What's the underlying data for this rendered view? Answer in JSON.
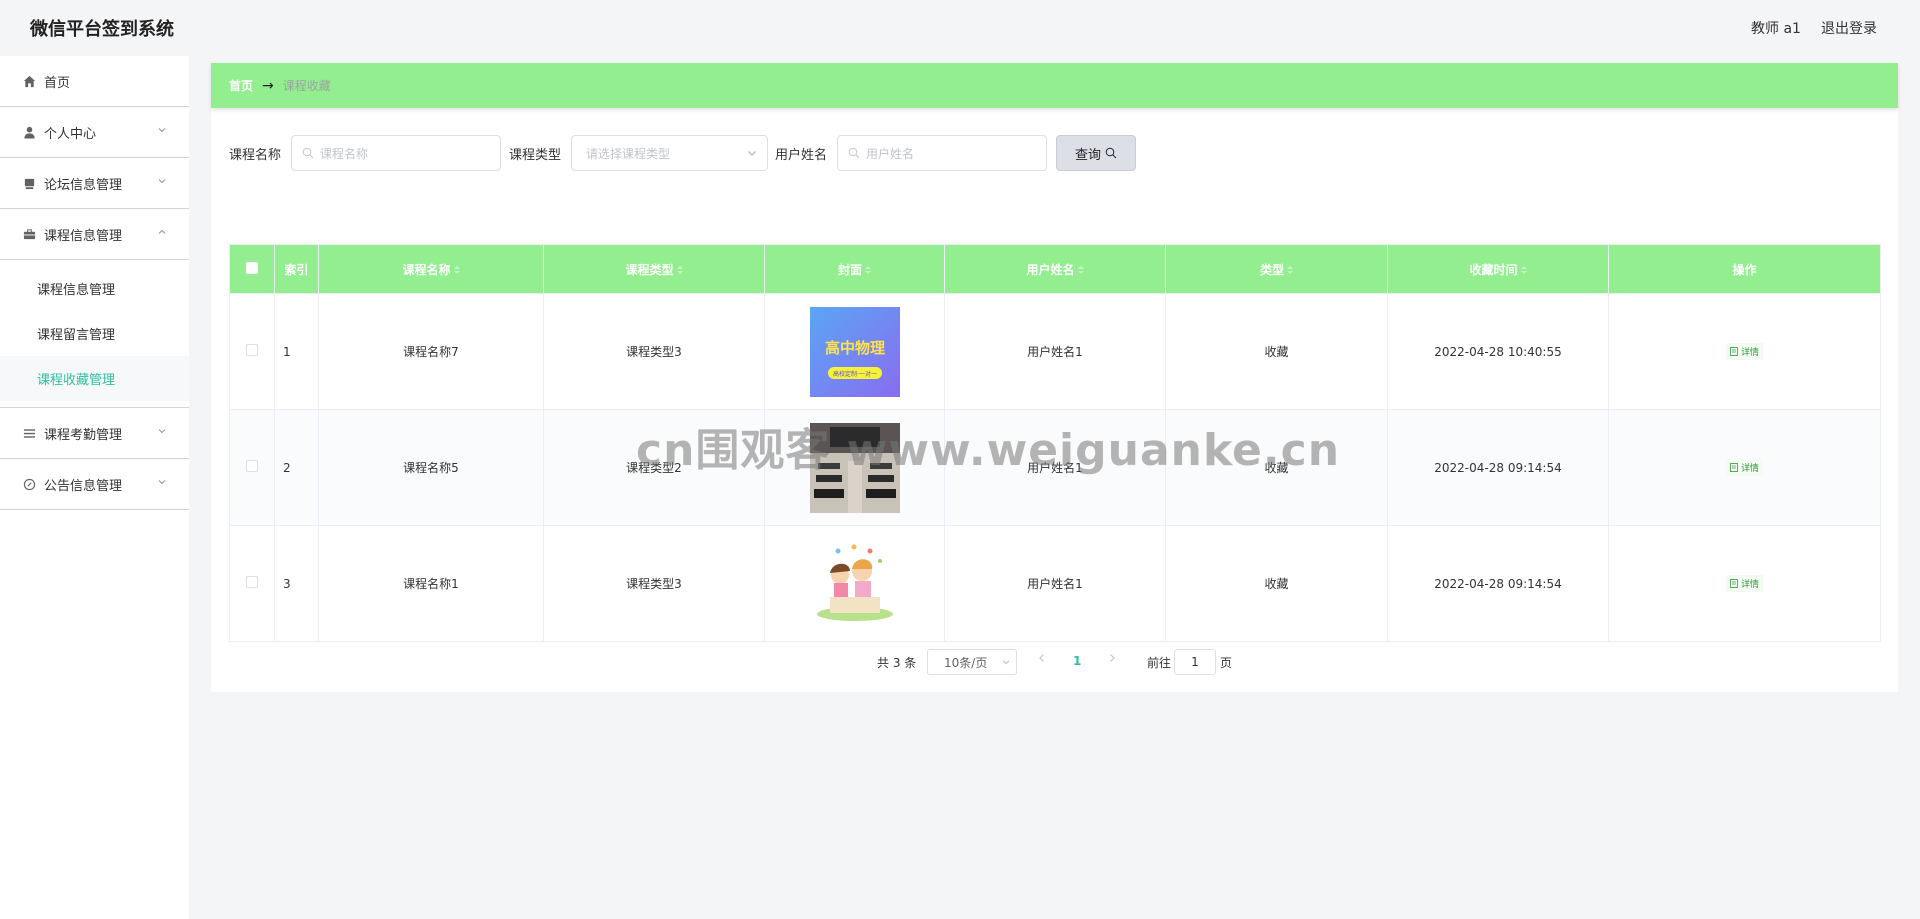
{
  "header": {
    "app_title": "微信平台签到系统",
    "user": "教师 a1",
    "logout": "退出登录"
  },
  "sidebar": {
    "items": [
      {
        "label": "首页",
        "icon": "home-icon"
      },
      {
        "label": "个人中心",
        "icon": "user-icon"
      },
      {
        "label": "论坛信息管理",
        "icon": "forum-icon"
      },
      {
        "label": "课程信息管理",
        "icon": "briefcase-icon"
      },
      {
        "label": "课程考勤管理",
        "icon": "list-icon"
      },
      {
        "label": "公告信息管理",
        "icon": "compass-icon"
      }
    ],
    "submenu": [
      {
        "label": "课程信息管理",
        "active": false
      },
      {
        "label": "课程留言管理",
        "active": false
      },
      {
        "label": "课程收藏管理",
        "active": true
      }
    ]
  },
  "breadcrumb": {
    "home": "首页",
    "separator": "→",
    "current": "课程收藏"
  },
  "search": {
    "course_name_label": "课程名称",
    "course_name_placeholder": "课程名称",
    "course_type_label": "课程类型",
    "course_type_placeholder": "请选择课程类型",
    "user_name_label": "用户姓名",
    "user_name_placeholder": "用户姓名",
    "query_button": "查询"
  },
  "table": {
    "columns": [
      "索引",
      "课程名称",
      "课程类型",
      "封面",
      "用户姓名",
      "类型",
      "收藏时间",
      "操作"
    ],
    "rows": [
      {
        "index": "1",
        "course_name": "课程名称7",
        "course_type": "课程类型3",
        "cover_text": "高中物理",
        "cover_sub": "高校定制·一对一",
        "user_name": "用户姓名1",
        "type": "收藏",
        "time": "2022-04-28 10:40:55",
        "action": "详情"
      },
      {
        "index": "2",
        "course_name": "课程名称5",
        "course_type": "课程类型2",
        "user_name": "用户姓名1",
        "type": "收藏",
        "time": "2022-04-28 09:14:54",
        "action": "详情"
      },
      {
        "index": "3",
        "course_name": "课程名称1",
        "course_type": "课程类型3",
        "user_name": "用户姓名1",
        "type": "收藏",
        "time": "2022-04-28 09:14:54",
        "action": "详情"
      }
    ]
  },
  "pagination": {
    "total": "共 3 条",
    "page_size": "10条/页",
    "current_page": "1",
    "goto_label": "前往",
    "goto_value": "1",
    "page_label": "页"
  },
  "watermark": "cn围观客 www.weiguanke.cn",
  "colors": {
    "accent_green": "#93ee8f",
    "active_teal": "#2fc0a0"
  }
}
